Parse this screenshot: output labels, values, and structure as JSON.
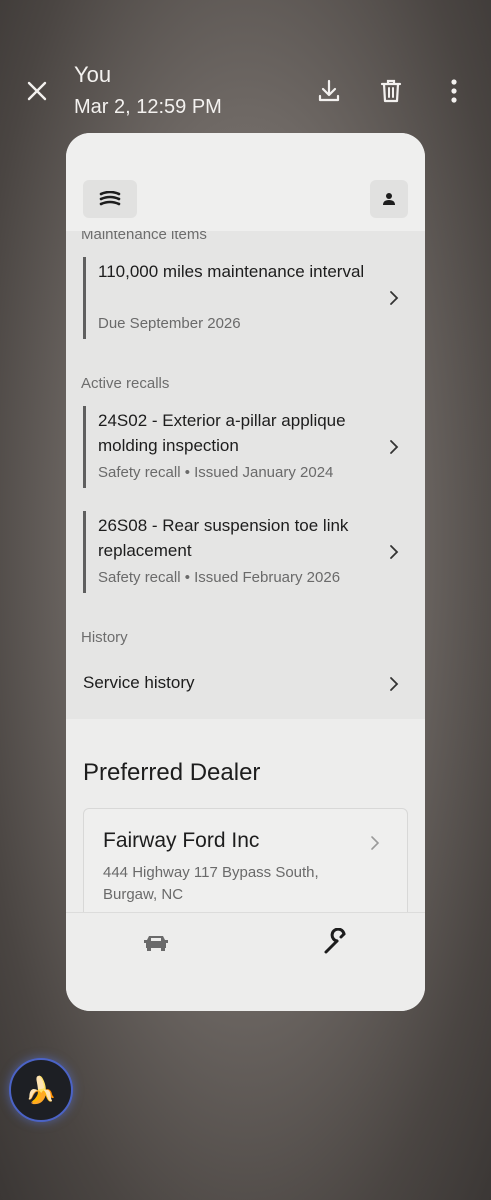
{
  "viewer": {
    "sender": "You",
    "timestamp": "Mar 2, 12:59 PM",
    "icons": [
      "close-icon",
      "download-icon",
      "trash-icon",
      "more-vertical-icon"
    ]
  },
  "app": {
    "header_icons": [
      "hamburger-menu-icon",
      "person-icon"
    ],
    "maintenance": {
      "label": "Maintenance items",
      "items": [
        {
          "title": "110,000 miles maintenance interval",
          "subtitle": "Due September 2026"
        }
      ]
    },
    "recalls": {
      "label": "Active recalls",
      "items": [
        {
          "title": "24S02 - Exterior a-pillar applique molding inspection",
          "subtitle": "Safety recall • Issued January 2024"
        },
        {
          "title": "26S08 - Rear suspension toe link replacement",
          "subtitle": "Safety recall • Issued February 2026"
        }
      ]
    },
    "history": {
      "label": "History",
      "service_history": "Service history"
    },
    "dealer": {
      "heading": "Preferred Dealer",
      "name": "Fairway Ford Inc",
      "address": "444 Highway 117 Bypass South, Burgaw, NC"
    },
    "bottom_nav": [
      "car-icon",
      "wrench-icon"
    ]
  },
  "fab_emoji": "🍌",
  "colors": {
    "card_bg": "#ededec",
    "section_bg": "#e5e5e4",
    "item_bar": "#5f5f5f",
    "fab_ring": "#4b63c6"
  }
}
